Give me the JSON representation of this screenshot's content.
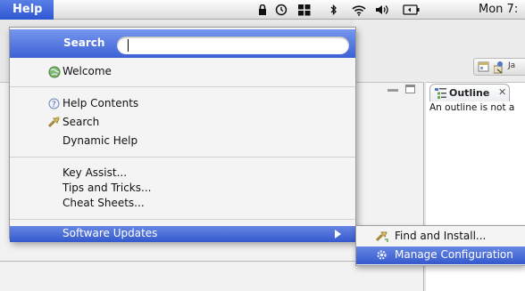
{
  "menubar": {
    "app_menu": "Help",
    "clock": "Mon 7:",
    "status_icons": [
      "lock-icon",
      "time-machine-icon",
      "spaces-icon",
      "bluetooth-icon",
      "wifi-icon",
      "volume-icon",
      "battery-icon"
    ]
  },
  "help_menu": {
    "search": {
      "label": "Search",
      "value": ""
    },
    "items": [
      {
        "label": "Welcome",
        "icon": "welcome-globe-icon"
      },
      {
        "label": "Help Contents",
        "icon": "help-circle-icon"
      },
      {
        "label": "Search",
        "icon": "search-flashlight-icon"
      },
      {
        "label": "Dynamic Help",
        "icon": ""
      },
      {
        "label": "Key Assist...",
        "icon": ""
      },
      {
        "label": "Tips and Tricks...",
        "icon": ""
      },
      {
        "label": "Cheat Sheets...",
        "icon": ""
      },
      {
        "label": "Software Updates",
        "icon": "",
        "has_submenu": true,
        "highlighted": true
      }
    ]
  },
  "software_updates_submenu": {
    "items": [
      {
        "label": "Find and Install...",
        "icon": "find-install-icon"
      },
      {
        "label": "Manage Configuration",
        "icon": "gear-icon",
        "highlighted": true
      }
    ]
  },
  "workbench": {
    "perspective_label": "Ja",
    "outline_tab": {
      "label": "Outline",
      "close": "✕"
    },
    "outline_message": "An outline is not a"
  },
  "colors": {
    "selection": "#3c62d5",
    "menu_bg": "#f4f4f4",
    "menubar_bg": "#e5e5e5"
  }
}
